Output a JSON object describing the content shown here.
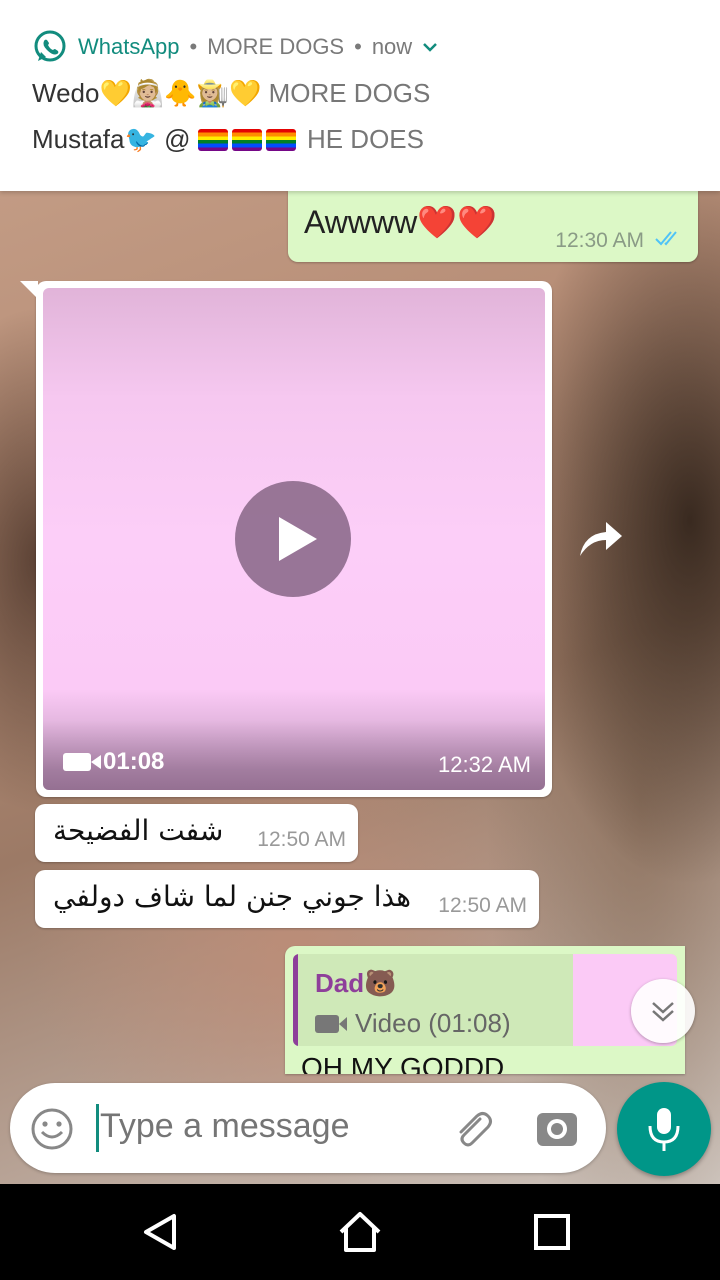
{
  "notification": {
    "app_name": "WhatsApp",
    "group": "MORE DOGS",
    "time": "now",
    "line1_sender": "Wedo💛👰🏼🐥👩🏼‍🌾💛",
    "line1_group": "MORE DOGS",
    "line2_sender": "Mustafa🐦 @",
    "line2_text": "HE DOES"
  },
  "messages": [
    {
      "type": "text",
      "direction": "out",
      "text": "Awwww❤️❤️",
      "time": "12:30 AM",
      "status": "read"
    },
    {
      "type": "video",
      "direction": "in",
      "duration": "01:08",
      "time": "12:32 AM"
    },
    {
      "type": "text",
      "direction": "in",
      "text": "شفت الفضيحة",
      "time": "12:50 AM"
    },
    {
      "type": "text",
      "direction": "in",
      "text": "هذا جوني جنن لما شاف دولفي",
      "time": "12:50 AM"
    },
    {
      "type": "reply",
      "direction": "out",
      "quote_author": "Dad🐻",
      "quote_text": "Video (01:08)",
      "text": "OH MY GODDD"
    }
  ],
  "composer": {
    "placeholder": "Type a message"
  },
  "colors": {
    "out_bubble": "#dcf8c6",
    "in_bubble": "#ffffff",
    "accent": "#009688",
    "whatsapp_green": "#128c7e",
    "read_ticks": "#4fc3f7",
    "quote_author": "#8e3f9a"
  },
  "icons": [
    "whatsapp-icon",
    "chevron-down-icon",
    "read-ticks-icon",
    "play-icon",
    "video-camera-icon",
    "forward-icon",
    "scroll-down-icon",
    "emoji-icon",
    "attach-icon",
    "camera-icon",
    "mic-icon",
    "nav-back-icon",
    "nav-home-icon",
    "nav-recents-icon"
  ]
}
